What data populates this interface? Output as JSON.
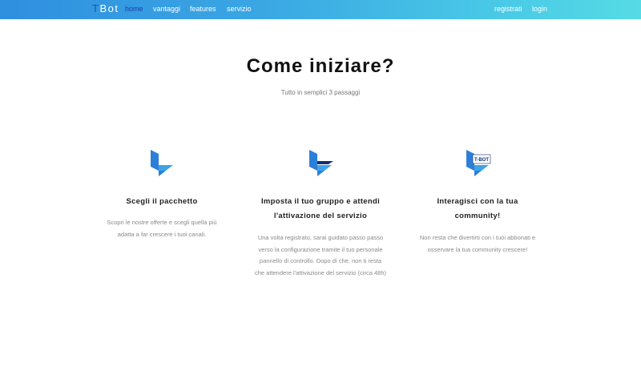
{
  "nav": {
    "brand_first": "T",
    "brand_rest": "Bot",
    "links": [
      {
        "label": "home"
      },
      {
        "label": "vantaggi"
      },
      {
        "label": "features"
      },
      {
        "label": "servizio"
      }
    ],
    "right_links": [
      {
        "label": "registrati"
      },
      {
        "label": "login"
      }
    ],
    "colors": {
      "gradient_start": "#2f8fe0",
      "gradient_end": "#55dbe5",
      "active": "#1a3fa8"
    }
  },
  "hero": {
    "title": "Come iniziare?",
    "subtitle": "Tutto in semplici 3 passaggi"
  },
  "steps": [
    {
      "icon": "tbot-logo-icon",
      "title": "Scegli il pacchetto",
      "description": "Scopri le nostre offerte e scegli quella più adatta a far crescere i tuoi canali."
    },
    {
      "icon": "tbot-logo-configured-icon",
      "title": "Imposta il tuo gruppo e attendi l'attivazione del servizio",
      "description": "Una volta registrato, sarai guidato passo passo verso la configurazione tramite il tuo personale pannello di controllo. Dopo di che, non ti resta che attendere l'attivazione del servizio (circa 48h)"
    },
    {
      "icon": "tbot-logo-active-icon",
      "badge": "T-BOT",
      "title": "Interagisci con la tua community!",
      "description": "Non resta che divertirti con i tuoi abbonati e osservare la tua community crescere!"
    }
  ]
}
